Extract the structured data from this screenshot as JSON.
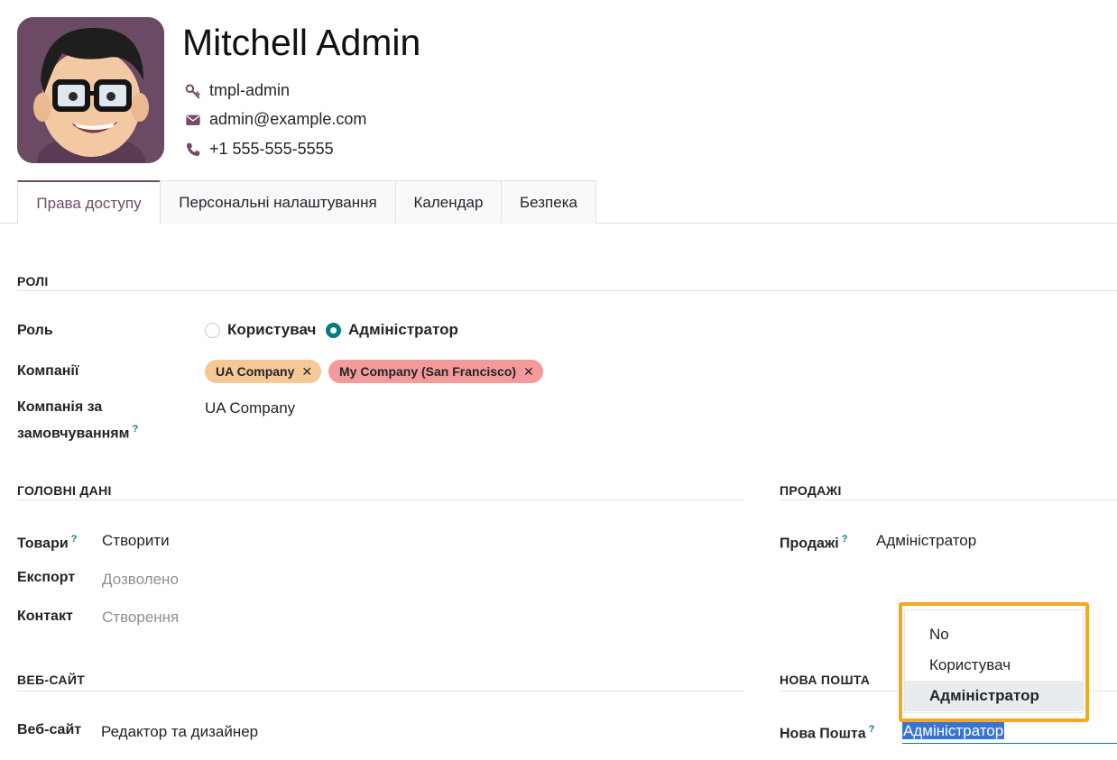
{
  "user": {
    "name": "Mitchell Admin",
    "login": "tmpl-admin",
    "email": "admin@example.com",
    "phone": "+1 555-555-5555"
  },
  "icons": {
    "login": "key-icon",
    "email": "envelope-icon",
    "phone": "phone-icon"
  },
  "tabs": [
    {
      "label": "Права доступу",
      "active": true
    },
    {
      "label": "Персональні налаштування",
      "active": false
    },
    {
      "label": "Календар",
      "active": false
    },
    {
      "label": "Безпека",
      "active": false
    }
  ],
  "roles": {
    "title": "РОЛІ",
    "role_label": "Роль",
    "role_options": [
      "Користувач",
      "Адміністратор"
    ],
    "role_selected": "Адміністратор",
    "companies_label": "Компанії",
    "companies": [
      {
        "name": "UA Company",
        "color": "#f6c898"
      },
      {
        "name": "My Company (San Francisco)",
        "color": "#f59a9a"
      }
    ],
    "default_company_label_1": "Компанія за",
    "default_company_label_2": "замовчуванням",
    "default_company_value": "UA Company",
    "help_mark": "?"
  },
  "main_data": {
    "title": "ГОЛОВНІ ДАНІ",
    "products_label": "Товари",
    "products_value": "Створити",
    "export_label": "Експорт",
    "export_value": "Дозволено",
    "contact_label": "Контакт",
    "contact_value": "Створення"
  },
  "sales": {
    "title": "ПРОДАЖІ",
    "sales_label": "Продажі",
    "sales_value": "Адміністратор"
  },
  "website": {
    "title": "ВЕБ-САЙТ",
    "website_label": "Веб-сайт",
    "website_value": "Редактор та дизайнер"
  },
  "nova_poshta": {
    "title": "НОВА ПОШТА",
    "label": "Нова Пошта",
    "value": "Адміністратор",
    "dropdown_options": [
      "No",
      "Користувач",
      "Адміністратор"
    ],
    "dropdown_selected": "Адміністратор"
  },
  "colors": {
    "accent": "#714b67",
    "teal": "#017e84",
    "highlight": "#f5a623",
    "selection": "#3874d8"
  }
}
